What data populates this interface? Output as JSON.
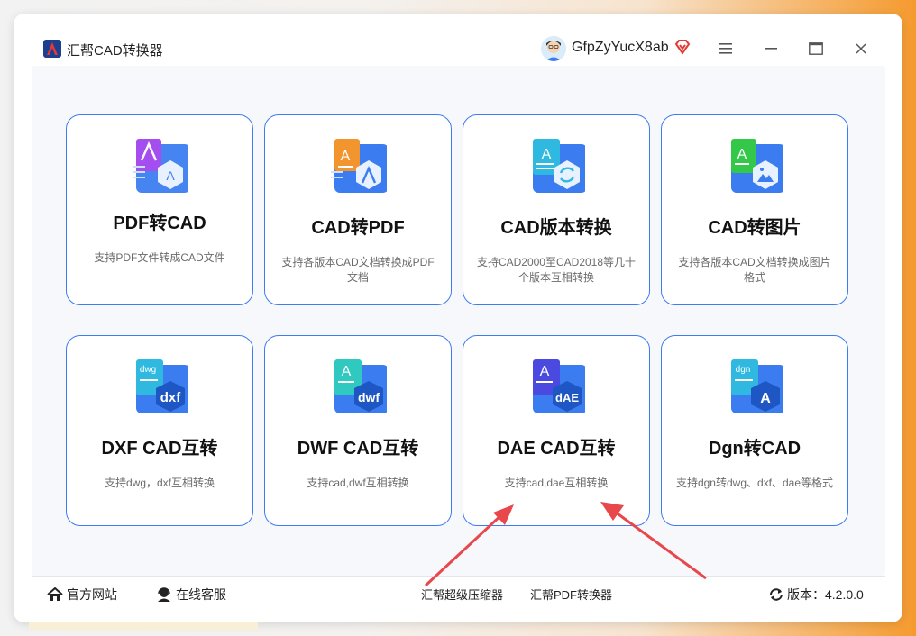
{
  "app": {
    "title": "汇帮CAD转换器"
  },
  "user": {
    "name": "GfpZyYucX8ab"
  },
  "icons": {
    "menu": "menu-icon",
    "minimize": "minimize-icon",
    "maximize": "maximize-icon",
    "close": "close-icon"
  },
  "colors": {
    "accent": "#3d7cf0",
    "arrow": "#e8474c",
    "vip": "#e53935"
  },
  "cards": [
    {
      "title": "PDF转CAD",
      "desc": "支持PDF文件转成CAD文件",
      "icon": "pdf-to-cad-icon",
      "badge": "",
      "accent": "#a44ef0"
    },
    {
      "title": "CAD转PDF",
      "desc": "支持各版本CAD文档转换成PDF文档",
      "icon": "cad-to-pdf-icon",
      "badge": "",
      "accent": "#f2952f"
    },
    {
      "title": "CAD版本转换",
      "desc": "支持CAD2000至CAD2018等几十个版本互相转换",
      "icon": "cad-version-convert-icon",
      "badge": "",
      "accent": "#2fb9e0"
    },
    {
      "title": "CAD转图片",
      "desc": "支持各版本CAD文档转换成图片格式",
      "icon": "cad-to-image-icon",
      "badge": "",
      "accent": "#34c84a"
    },
    {
      "title": "DXF CAD互转",
      "desc": "支持dwg，dxf互相转换",
      "icon": "dxf-cad-icon",
      "badge": "dxf",
      "accent": "#2fb9e0"
    },
    {
      "title": "DWF CAD互转",
      "desc": "支持cad,dwf互相转换",
      "icon": "dwf-cad-icon",
      "badge": "dwf",
      "accent": "#2fc9c0"
    },
    {
      "title": "DAE CAD互转",
      "desc": "支持cad,dae互相转换",
      "icon": "dae-cad-icon",
      "badge": "dAE",
      "accent": "#4a4ae0"
    },
    {
      "title": "Dgn转CAD",
      "desc": "支持dgn转dwg、dxf、dae等格式",
      "icon": "dgn-cad-icon",
      "badge": "A",
      "accent": "#2fb9e0"
    }
  ],
  "footer": {
    "website": "官方网站",
    "support": "在线客服",
    "link1": "汇帮超级压缩器",
    "link2": "汇帮PDF转换器",
    "version": "版本：4.2.0.0"
  }
}
